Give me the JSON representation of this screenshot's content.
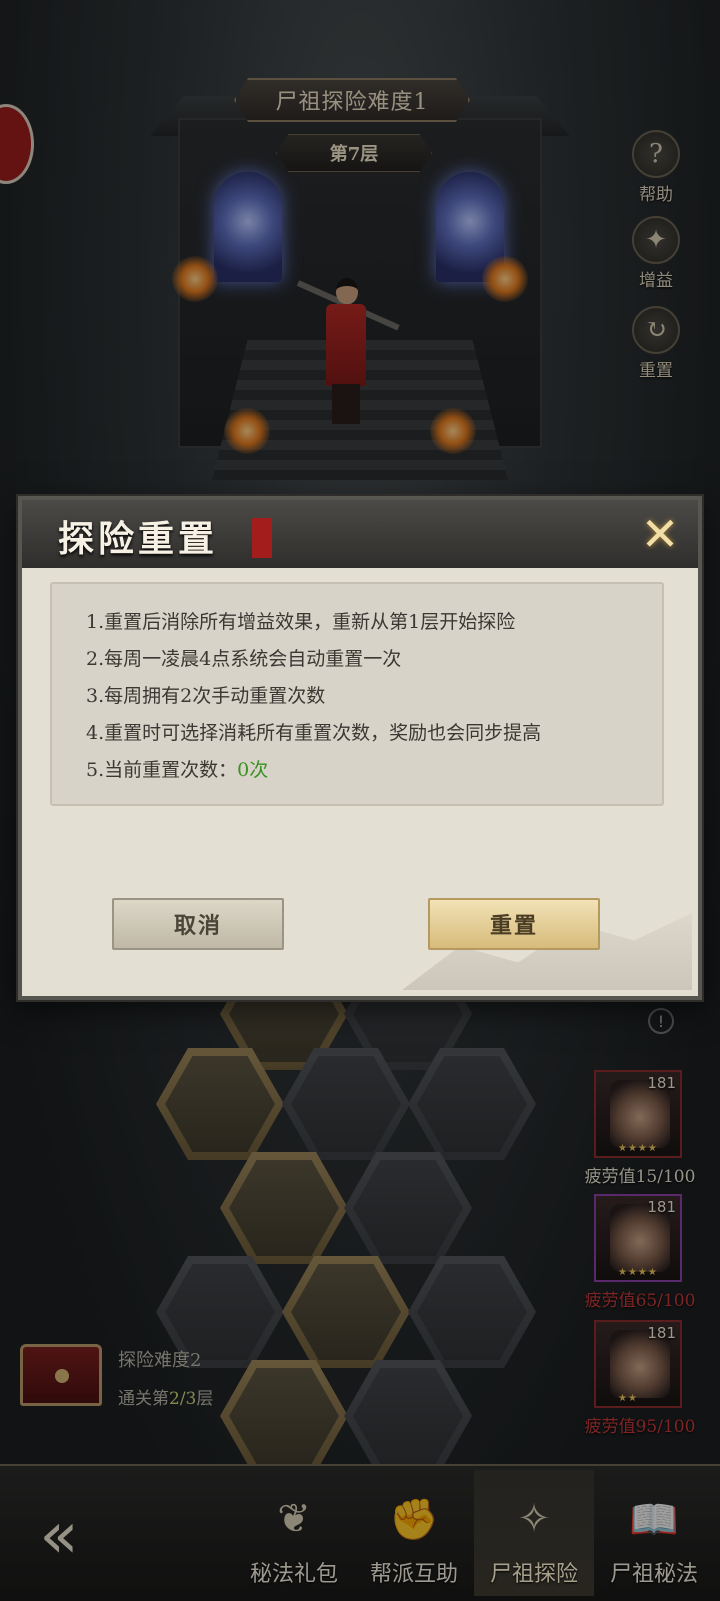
{
  "scene": {
    "title": "尸祖探险难度1",
    "floor": "第7层",
    "side_buttons": [
      {
        "label": "帮助",
        "icon": "question-icon",
        "glyph": "?"
      },
      {
        "label": "增益",
        "icon": "buff-icon",
        "glyph": "✦"
      },
      {
        "label": "重置",
        "icon": "reset-icon",
        "glyph": "↻"
      }
    ],
    "alert_glyph": "!"
  },
  "heroes": [
    {
      "level": "181",
      "stars": "★★★★",
      "fatigue": "疲劳值15/100",
      "fatigue_color": "#e8e2d2"
    },
    {
      "level": "181",
      "stars": "★★★★",
      "fatigue": "疲劳值65/100",
      "fatigue_color": "#c43a3a"
    },
    {
      "level": "181",
      "stars": "★★",
      "fatigue": "疲劳值95/100",
      "fatigue_color": "#c43a3a"
    }
  ],
  "chest": {
    "title": "探险难度2",
    "progress_prefix": "通关第",
    "progress_value": "2/3",
    "progress_suffix": "层"
  },
  "nav": {
    "back_glyph": "«",
    "items": [
      {
        "label": "秘法礼包",
        "icon": "pouch-icon",
        "glyph": "❦",
        "active": false
      },
      {
        "label": "帮派互助",
        "icon": "handshake-icon",
        "glyph": "✊",
        "active": false
      },
      {
        "label": "尸祖探险",
        "icon": "crystal-icon",
        "glyph": "✧",
        "active": true
      },
      {
        "label": "尸祖秘法",
        "icon": "book-icon",
        "glyph": "📖",
        "active": false
      }
    ]
  },
  "modal": {
    "title": "探险重置",
    "close_glyph": "✕",
    "rules": [
      "1.重置后消除所有增益效果，重新从第1层开始探险",
      "2.每周一凌晨4点系统会自动重置一次",
      "3.每周拥有2次手动重置次数",
      "4.重置时可选择消耗所有重置次数，奖励也会同步提高"
    ],
    "count_label": "5.当前重置次数：",
    "count_value": "0次",
    "count_color": "#3b8f24",
    "cancel_label": "取消",
    "confirm_label": "重置"
  }
}
